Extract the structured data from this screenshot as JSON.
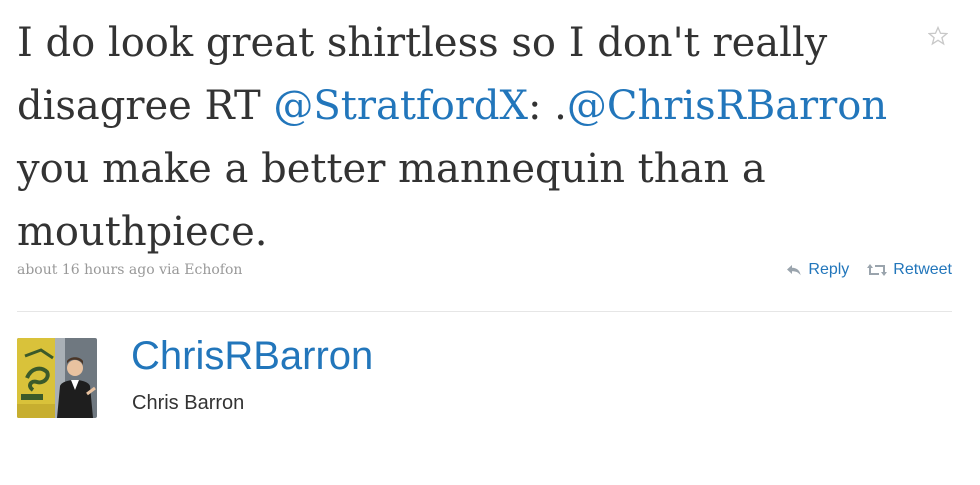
{
  "tweet": {
    "text_parts": {
      "p1": "I do look great shirtless so I don't really disagree RT ",
      "mention1": "@StratfordX",
      "p2": ": .",
      "mention2": "@ChrisRBarron",
      "p3": " you make a better mannequin than a mouthpiece."
    },
    "meta": "about 16 hours ago via Echofon",
    "reply_label": "Reply",
    "retweet_label": "Retweet",
    "favorite_icon": "star-icon"
  },
  "user": {
    "username": "ChrisRBarron",
    "full_name": "Chris Barron",
    "avatar_icon": "avatar"
  },
  "colors": {
    "link": "#2276bb",
    "text": "#333333",
    "meta": "#999999"
  }
}
